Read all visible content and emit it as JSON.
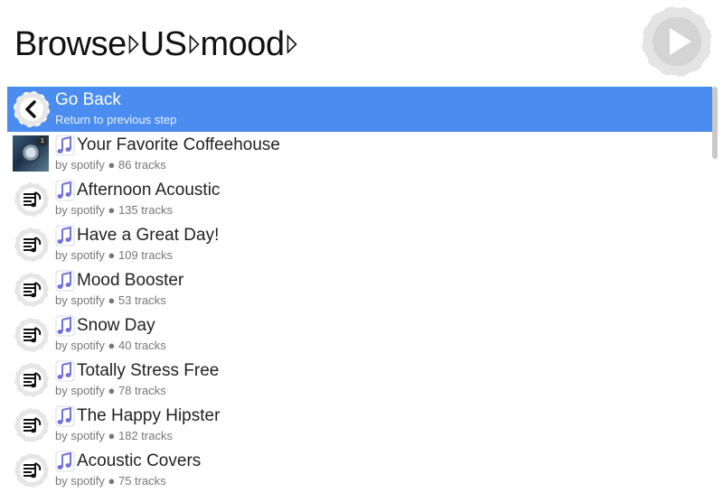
{
  "breadcrumb": {
    "items": [
      "Browse",
      "US",
      "mood"
    ]
  },
  "colors": {
    "selected_row": "#4a8cf0",
    "note_icon": "#6f72d6",
    "disc_icon": "#e6e6e6"
  },
  "back_row": {
    "title": "Go Back",
    "subtitle": "Return to previous step",
    "icon": "chevron-left-icon"
  },
  "playlists": [
    {
      "title": "Your Favorite Coffeehouse",
      "subtitle": "by spotify ● 86 tracks",
      "thumb": "album-art",
      "badge": "1"
    },
    {
      "title": "Afternoon Acoustic",
      "subtitle": "by spotify ● 135 tracks",
      "thumb": "playlist-icon"
    },
    {
      "title": "Have a Great Day!",
      "subtitle": "by spotify ● 109 tracks",
      "thumb": "playlist-icon"
    },
    {
      "title": "Mood Booster",
      "subtitle": "by spotify ● 53 tracks",
      "thumb": "playlist-icon"
    },
    {
      "title": "Snow Day",
      "subtitle": "by spotify ● 40 tracks",
      "thumb": "playlist-icon"
    },
    {
      "title": "Totally Stress Free",
      "subtitle": "by spotify ● 78 tracks",
      "thumb": "playlist-icon"
    },
    {
      "title": "The Happy Hipster",
      "subtitle": "by spotify ● 182 tracks",
      "thumb": "playlist-icon"
    },
    {
      "title": "Acoustic Covers",
      "subtitle": "by spotify ● 75 tracks",
      "thumb": "playlist-icon"
    }
  ]
}
